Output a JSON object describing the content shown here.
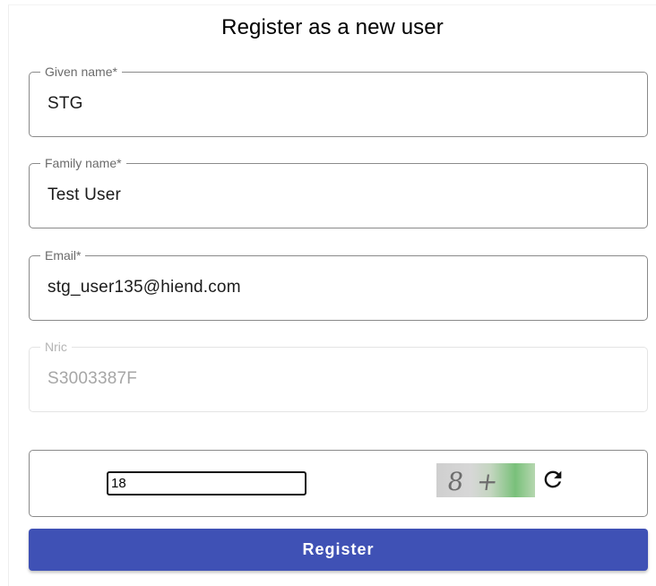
{
  "form": {
    "title": "Register as a new user",
    "fields": [
      {
        "label": "Given name*",
        "value": "STG"
      },
      {
        "label": "Family name*",
        "value": "Test User"
      },
      {
        "label": "Email*",
        "value": "stg_user135@hiend.com"
      },
      {
        "label": "Nric",
        "value": "S3003387F"
      }
    ],
    "captcha": {
      "input_value": "18",
      "image_text": "8 + 10",
      "refresh_icon": "refresh-icon"
    },
    "register_label": "Register"
  },
  "colors": {
    "primary": "#3f51b5",
    "border": "#8a8a8a",
    "disabled_text": "#a6a6a6"
  }
}
